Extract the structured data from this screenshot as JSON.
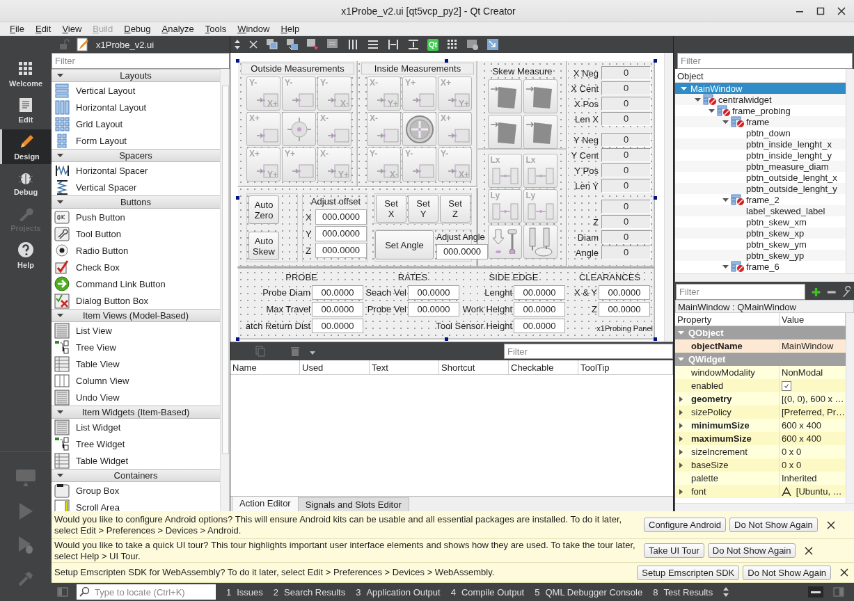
{
  "window": {
    "title": "x1Probe_v2.ui [qt5vcp_py2] - Qt Creator"
  },
  "menu": [
    {
      "label": "File",
      "disabled": false
    },
    {
      "label": "Edit",
      "disabled": false
    },
    {
      "label": "View",
      "disabled": false
    },
    {
      "label": "Build",
      "disabled": true
    },
    {
      "label": "Debug",
      "disabled": false
    },
    {
      "label": "Analyze",
      "disabled": false
    },
    {
      "label": "Tools",
      "disabled": false
    },
    {
      "label": "Window",
      "disabled": false
    },
    {
      "label": "Help",
      "disabled": false
    }
  ],
  "modes": [
    {
      "label": "Welcome",
      "kind": "welcome",
      "selected": false,
      "disabled": false
    },
    {
      "label": "Edit",
      "kind": "edit",
      "selected": false,
      "disabled": false
    },
    {
      "label": "Design",
      "kind": "design",
      "selected": true,
      "disabled": false
    },
    {
      "label": "Debug",
      "kind": "debug",
      "selected": false,
      "disabled": false
    },
    {
      "label": "Projects",
      "kind": "projects",
      "selected": false,
      "disabled": true
    },
    {
      "label": "Help",
      "kind": "help",
      "selected": false,
      "disabled": false
    }
  ],
  "widget_box": {
    "file": "x1Probe_v2.ui",
    "filter_placeholder": "Filter",
    "sections": [
      {
        "title": "Layouts",
        "items": [
          {
            "label": "Vertical Layout",
            "kind": "vlayout"
          },
          {
            "label": "Horizontal Layout",
            "kind": "hlayout"
          },
          {
            "label": "Grid Layout",
            "kind": "grid"
          },
          {
            "label": "Form Layout",
            "kind": "form"
          }
        ]
      },
      {
        "title": "Spacers",
        "items": [
          {
            "label": "Horizontal Spacer",
            "kind": "hspacer"
          },
          {
            "label": "Vertical Spacer",
            "kind": "vspacer"
          }
        ]
      },
      {
        "title": "Buttons",
        "items": [
          {
            "label": "Push Button",
            "kind": "push"
          },
          {
            "label": "Tool Button",
            "kind": "tool"
          },
          {
            "label": "Radio Button",
            "kind": "radio"
          },
          {
            "label": "Check Box",
            "kind": "check"
          },
          {
            "label": "Command Link Button",
            "kind": "command"
          },
          {
            "label": "Dialog Button Box",
            "kind": "dialog"
          }
        ]
      },
      {
        "title": "Item Views (Model-Based)",
        "items": [
          {
            "label": "List View",
            "kind": "list"
          },
          {
            "label": "Tree View",
            "kind": "tree"
          },
          {
            "label": "Table View",
            "kind": "table"
          },
          {
            "label": "Column View",
            "kind": "column"
          },
          {
            "label": "Undo View",
            "kind": "list"
          }
        ]
      },
      {
        "title": "Item Widgets (Item-Based)",
        "items": [
          {
            "label": "List Widget",
            "kind": "list"
          },
          {
            "label": "Tree Widget",
            "kind": "tree"
          },
          {
            "label": "Table Widget",
            "kind": "table"
          }
        ]
      },
      {
        "title": "Containers",
        "items": [
          {
            "label": "Group Box",
            "kind": "group"
          },
          {
            "label": "Scroll Area",
            "kind": "scroll"
          }
        ]
      }
    ]
  },
  "form_toolbar": {
    "logo_text": "Qt"
  },
  "form": {
    "outside": {
      "title": "Outside Measurements",
      "buttons": [
        {
          "kind": "edge",
          "marks": [
            "Y-",
            "X+"
          ]
        },
        {
          "kind": "edge",
          "marks": [
            "Y-"
          ]
        },
        {
          "kind": "edge",
          "marks": [
            "Y-",
            "X-"
          ]
        },
        {
          "kind": "edge",
          "marks": [
            "X+"
          ]
        },
        {
          "kind": "center"
        },
        {
          "kind": "edge",
          "marks": [
            "X-"
          ]
        },
        {
          "kind": "edge",
          "marks": [
            "X+",
            "Y+"
          ]
        },
        {
          "kind": "edge",
          "marks": [
            "Y+"
          ]
        },
        {
          "kind": "edge",
          "marks": [
            "X-",
            "Y+"
          ]
        }
      ]
    },
    "inside": {
      "title": "Inside Measurements",
      "buttons": [
        {
          "kind": "edge",
          "marks": [
            "X-",
            "Y+"
          ]
        },
        {
          "kind": "edge",
          "marks": [
            "Y+"
          ]
        },
        {
          "kind": "edge",
          "marks": [
            "X+",
            "Y+"
          ]
        },
        {
          "kind": "edge",
          "marks": [
            "X-"
          ]
        },
        {
          "kind": "boss"
        },
        {
          "kind": "edge",
          "marks": [
            "X+"
          ]
        },
        {
          "kind": "edge",
          "marks": [
            "Y-",
            "X-"
          ]
        },
        {
          "kind": "edge",
          "marks": [
            "Y-"
          ]
        },
        {
          "kind": "edge",
          "marks": [
            "Y-",
            "X+"
          ]
        }
      ]
    },
    "skew": {
      "title": "Skew Measure",
      "buttons": [
        {
          "kind": "skew"
        },
        {
          "kind": "skew"
        },
        {
          "kind": "skew"
        },
        {
          "kind": "skew"
        }
      ]
    },
    "length_buttons": [
      {
        "kind": "length",
        "marks": [
          "Lx"
        ]
      },
      {
        "kind": "length",
        "marks": [
          "Lx"
        ]
      },
      {
        "kind": "length",
        "marks": [
          "Ly"
        ]
      },
      {
        "kind": "length",
        "marks": [
          "Ly"
        ]
      },
      {
        "kind": "down"
      },
      {
        "kind": "tool"
      }
    ],
    "readouts": [
      {
        "label": "X Neg",
        "value": "0"
      },
      {
        "label": "X Cent",
        "value": "0"
      },
      {
        "label": "X Pos",
        "value": "0"
      },
      {
        "label": "Len X",
        "value": "0"
      },
      {
        "label": "Y Neg",
        "value": "0"
      },
      {
        "label": "Y Cent",
        "value": "0"
      },
      {
        "label": "Y Pos",
        "value": "0"
      },
      {
        "label": "Len Y",
        "value": "0"
      },
      {
        "value": "0"
      },
      {
        "label": "Z",
        "value": "0"
      },
      {
        "label": "Diam",
        "value": "0"
      },
      {
        "label": "Angle",
        "value": "0"
      }
    ],
    "auto_buttons": [
      "Auto Zero",
      "Auto Skew"
    ],
    "adjust_offset": {
      "title": "Adjust offset",
      "fields": [
        {
          "axis": "X",
          "value": "000.0000"
        },
        {
          "axis": "Y",
          "value": "000.0000"
        },
        {
          "axis": "Z",
          "value": "000.0000"
        }
      ]
    },
    "set_buttons": [
      "Set X",
      "Set Y",
      "Set Z"
    ],
    "adjust_angle": {
      "title": "Adjust Angle",
      "value": "000.0000",
      "button": "Set Angle"
    },
    "settings": {
      "headers": [
        "PROBE",
        "RATES",
        "SIDE EDGE",
        "CLEARANCES"
      ],
      "rows": [
        [
          {
            "label": "Probe Diam",
            "value": "00.0000"
          },
          {
            "label": "Seach Vel",
            "value": "00.0000"
          },
          {
            "label": "Lenght",
            "value": "00.0000"
          },
          {
            "label": "X & Y",
            "value": "00.0000"
          }
        ],
        [
          {
            "label": "Max Travel",
            "value": "00.0000"
          },
          {
            "label": "Probe Vel",
            "value": "00.0000"
          },
          {
            "label": "Work Height",
            "value": "00.0000"
          },
          {
            "label": "Z",
            "value": "00.0000"
          }
        ],
        [
          {
            "label": "atch Return Dist",
            "value": "00.0000"
          },
          {
            "label": "Tool Sensor Height",
            "value": "00.0000"
          }
        ]
      ],
      "caption": "x1Probing  Panel"
    }
  },
  "action_editor": {
    "filter_placeholder": "Filter",
    "columns": [
      "Name",
      "Used",
      "Text",
      "Shortcut",
      "Checkable",
      "ToolTip"
    ],
    "tabs": [
      {
        "label": "Action Editor",
        "selected": true
      },
      {
        "label": "Signals and Slots Editor",
        "selected": false
      }
    ]
  },
  "object_inspector": {
    "filter_placeholder": "Filter",
    "header": "Object",
    "tree": [
      {
        "label": "MainWindow",
        "selected": true,
        "expanded": true,
        "children": [
          {
            "label": "centralwidget",
            "kind": "container",
            "selected": false,
            "expanded": true,
            "children": [
              {
                "label": "frame_probing",
                "kind": "container",
                "selected": false,
                "expanded": true,
                "children": [
                  {
                    "label": "frame",
                    "kind": "container",
                    "selected": false,
                    "expanded": true,
                    "children": [
                      {
                        "label": "pbtn_down",
                        "selected": false
                      },
                      {
                        "label": "pbtn_inside_lenght_x",
                        "selected": false
                      },
                      {
                        "label": "pbtn_inside_lenght_y",
                        "selected": false
                      },
                      {
                        "label": "pbtn_measure_diam",
                        "selected": false
                      },
                      {
                        "label": "pbtn_outside_lenght_x",
                        "selected": false
                      },
                      {
                        "label": "pbtn_outside_lenght_y",
                        "selected": false
                      }
                    ]
                  },
                  {
                    "label": "frame_2",
                    "kind": "container",
                    "selected": false,
                    "expanded": true,
                    "children": [
                      {
                        "label": "label_skewed_label",
                        "selected": false
                      },
                      {
                        "label": "pbtn_skew_xm",
                        "selected": false
                      },
                      {
                        "label": "pbtn_skew_xp",
                        "selected": false
                      },
                      {
                        "label": "pbtn_skew_ym",
                        "selected": false
                      },
                      {
                        "label": "pbtn_skew_yp",
                        "selected": false
                      }
                    ]
                  },
                  {
                    "label": "frame_6",
                    "kind": "container",
                    "selected": false,
                    "expanded": true
                  }
                ]
              }
            ]
          }
        ]
      }
    ]
  },
  "property_editor": {
    "filter_placeholder": "Filter",
    "class_label": "MainWindow : QMainWindow",
    "columns": [
      "Property",
      "Value"
    ],
    "rows": [
      {
        "kind": "group",
        "label": "QObject",
        "expanded": true
      },
      {
        "kind": "text",
        "name": "objectName",
        "value": "MainWindow",
        "changed": true,
        "expandable": false
      },
      {
        "kind": "group",
        "label": "QWidget",
        "expanded": true
      },
      {
        "kind": "text",
        "name": "windowModality",
        "value": "NonModal",
        "changed": false,
        "expandable": false
      },
      {
        "kind": "checkbox",
        "name": "enabled",
        "checked": true,
        "changed": false,
        "expandable": false
      },
      {
        "kind": "text",
        "name": "geometry",
        "value": "[(0, 0), 600 x …",
        "changed": true,
        "expandable": true
      },
      {
        "kind": "text",
        "name": "sizePolicy",
        "value": "[Preferred, Pr…",
        "changed": false,
        "expandable": true
      },
      {
        "kind": "text",
        "name": "minimumSize",
        "value": "600 x 400",
        "changed": true,
        "expandable": true
      },
      {
        "kind": "text",
        "name": "maximumSize",
        "value": "600 x 400",
        "changed": true,
        "expandable": true
      },
      {
        "kind": "text",
        "name": "sizeIncrement",
        "value": "0 x 0",
        "changed": false,
        "expandable": true
      },
      {
        "kind": "text",
        "name": "baseSize",
        "value": "0 x 0",
        "changed": false,
        "expandable": true
      },
      {
        "kind": "text",
        "name": "palette",
        "value": "Inherited",
        "changed": false,
        "expandable": false
      },
      {
        "kind": "font",
        "name": "font",
        "value": "[Ubuntu, …",
        "changed": false,
        "expandable": true
      }
    ]
  },
  "notifications": [
    {
      "text": "Would you like to configure Android options? This will ensure Android kits can be usable and all essential packages are installed. To do it later, select Edit > Preferences > Devices > Android.",
      "buttons": [
        "Configure Android",
        "Do Not Show Again"
      ]
    },
    {
      "text": "Would you like to take a quick UI tour? This tour highlights important user interface elements and shows how they are used. To take the tour later, select Help > UI Tour.",
      "buttons": [
        "Take UI Tour",
        "Do Not Show Again"
      ]
    },
    {
      "text": "Setup Emscripten SDK for WebAssembly? To do it later, select Edit > Preferences > Devices > WebAssembly.",
      "buttons": [
        "Setup Emscripten SDK",
        "Do Not Show Again"
      ]
    }
  ],
  "status_bar": {
    "locator_placeholder": "Type to locate (Ctrl+K)",
    "panes": [
      {
        "number": "1",
        "label": "Issues"
      },
      {
        "number": "2",
        "label": "Search Results"
      },
      {
        "number": "3",
        "label": "Application Output"
      },
      {
        "number": "4",
        "label": "Compile Output"
      },
      {
        "number": "5",
        "label": "QML Debugger Console"
      },
      {
        "number": "8",
        "label": "Test Results"
      }
    ]
  }
}
